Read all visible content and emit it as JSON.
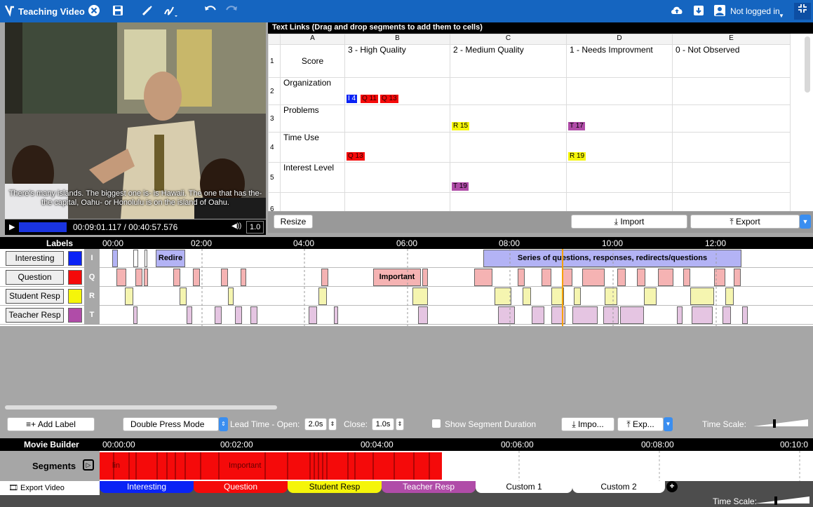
{
  "topbar": {
    "title": "Teaching Video",
    "login": "Not logged in",
    "icons": [
      "app-logo-icon",
      "close-icon",
      "save-icon",
      "pen-icon",
      "pen-tool-icon",
      "undo-icon",
      "redo-icon",
      "cloud-upload-icon",
      "download-box-icon",
      "user-icon",
      "collapse-icon"
    ]
  },
  "video": {
    "caption": "There's many islands. The biggest one is- is Hawaii. The one that has the- the capital, Oahu- or Honolulu is on the island of Oahu.",
    "time": "00:09:01.117 / 00:40:57.576",
    "speed": "1.0",
    "progress": 0.22
  },
  "textlinks": {
    "header": "Text Links (Drag and drop segments to add them to cells)",
    "columns": [
      "A",
      "B",
      "C",
      "D",
      "E"
    ],
    "rows": [
      {
        "num": "1",
        "a": "Score",
        "b": "3 - High Quality",
        "c": "2 - Medium Quality",
        "d": "1 - Needs Improvment",
        "e": "0 - Not Observed"
      },
      {
        "num": "2",
        "a": "Organization",
        "b": "",
        "c": "",
        "d": "",
        "e": ""
      },
      {
        "num": "3",
        "a": "Problems",
        "b": "",
        "c": "",
        "d": "",
        "e": ""
      },
      {
        "num": "4",
        "a": "Time Use",
        "b": "",
        "c": "",
        "d": "",
        "e": ""
      },
      {
        "num": "5",
        "a": "Interest Level",
        "b": "",
        "c": "",
        "d": "",
        "e": ""
      },
      {
        "num": "6",
        "a": "",
        "b": "",
        "c": "",
        "d": "",
        "e": ""
      }
    ],
    "chips": {
      "r2b": [
        "I 4",
        "Q 11",
        "Q 13"
      ],
      "r3c": "R 15",
      "r3d": "T 17",
      "r4b": "Q 13",
      "r4d": "R 19",
      "r5c": "T 19"
    },
    "resize": "Resize",
    "import": "Import",
    "export": "Export"
  },
  "timeline": {
    "labels_header": "Labels",
    "ticks": [
      "00:00",
      "02:00",
      "04:00",
      "06:00",
      "08:00",
      "10:00",
      "12:00"
    ],
    "tracks": [
      {
        "name": "Interesting",
        "key": "I",
        "color": "#0a23f5"
      },
      {
        "name": "Question",
        "key": "Q",
        "color": "#f50a0a"
      },
      {
        "name": "Student Resp",
        "key": "R",
        "color": "#f5f50a"
      },
      {
        "name": "Teacher Resp",
        "key": "T",
        "color": "#b04ca8"
      }
    ],
    "seg_texts": {
      "redire": "Redire",
      "series": "Series of questions, responses, redirects/questions",
      "important": "Important"
    }
  },
  "controls": {
    "add_label": "Add Label",
    "mode": "Double Press Mode",
    "lead_open_label": "Lead Time - Open:",
    "lead_open": "2.0s",
    "close_label": "Close:",
    "close": "1.0s",
    "show_duration": "Show Segment Duration",
    "import": "Impo...",
    "export": "Exp...",
    "time_scale": "Time Scale:"
  },
  "movie": {
    "header": "Movie Builder",
    "ticks": [
      "00:00:00",
      "00:02:00",
      "00:04:00",
      "00:06:00",
      "00:08:00",
      "00:10:0"
    ],
    "segments_label": "Segments",
    "seg_text_left": "lin",
    "seg_text_important": "Important",
    "export_video": "Export Video",
    "tabs": [
      "Interesting",
      "Question",
      "Student Resp",
      "Teacher Resp",
      "Custom 1",
      "Custom 2"
    ],
    "time_scale": "Time Scale:"
  }
}
